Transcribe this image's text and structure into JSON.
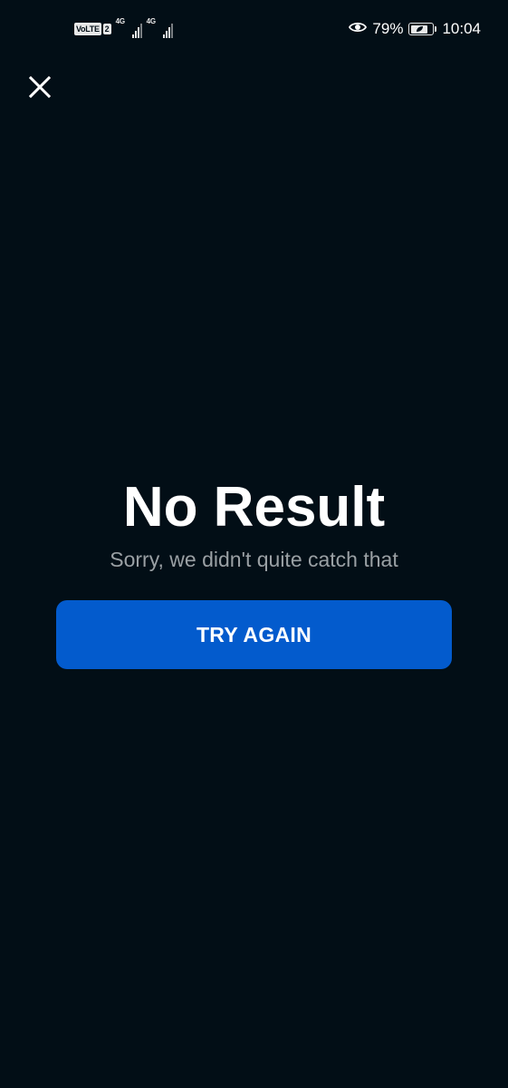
{
  "status_bar": {
    "volte_label": "VoLTE",
    "sim_number": "2",
    "sim1_network": "4G",
    "sim2_network": "4G",
    "battery_percent": "79%",
    "battery_level": 0.79,
    "time": "10:04",
    "icons": {
      "eye": "eye-icon",
      "battery": "battery-icon",
      "signal": "signal-icon"
    }
  },
  "close_button": {
    "icon": "close-icon"
  },
  "result": {
    "title": "No Result",
    "subtitle": "Sorry, we didn't quite catch that"
  },
  "actions": {
    "try_again_label": "TRY AGAIN"
  },
  "colors": {
    "background": "#020e16",
    "button": "#035bcd",
    "subtitle": "#9aa0a4"
  }
}
